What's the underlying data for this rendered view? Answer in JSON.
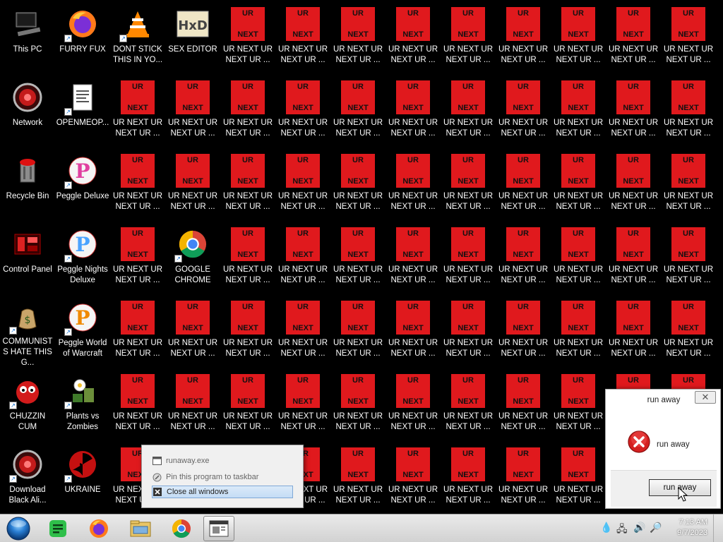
{
  "desktop": {
    "col1": [
      {
        "label": "This PC",
        "icon": "computer-icon"
      },
      {
        "label": "Network",
        "icon": "network-icon"
      },
      {
        "label": "Recycle Bin",
        "icon": "recycle-bin-icon"
      },
      {
        "label": "Control Panel",
        "icon": "control-panel-icon"
      },
      {
        "label": "COMMUNISTS HATE THIS G...",
        "icon": "money-bag-icon"
      },
      {
        "label": "CHUZZIN CUM",
        "icon": "chuzzle-icon"
      },
      {
        "label": "Download Black Ali...",
        "icon": "alien-icon"
      }
    ],
    "col2": [
      {
        "label": "FURRY FUX",
        "icon": "firefox-icon"
      },
      {
        "label": "OPENMEOP...",
        "icon": "document-icon"
      },
      {
        "label": "Peggle Deluxe",
        "icon": "peggle-icon"
      },
      {
        "label": "Peggle Nights Deluxe",
        "icon": "peggle-nights-icon"
      },
      {
        "label": "Peggle World of Warcraft",
        "icon": "peggle-wow-icon"
      },
      {
        "label": "Plants vs Zombies",
        "icon": "plants-icon"
      },
      {
        "label": "UKRAINE",
        "icon": "radiation-icon"
      }
    ],
    "col3_top": [
      {
        "label": "DONT STICK THIS IN YO...",
        "icon": "vlc-icon"
      },
      {
        "label": "SEX EDITOR",
        "icon": "hxd-icon"
      }
    ],
    "chrome": {
      "label": "GOOGLE CHROME",
      "icon": "chrome-icon"
    },
    "ur_icon": {
      "top": "UR",
      "bottom": "NEXT",
      "label": "UR NEXT UR NEXT UR ..."
    }
  },
  "jumplist": {
    "app": "runaway.exe",
    "pin": "Pin this program to taskbar",
    "close": "Close all windows"
  },
  "dialog": {
    "title": "run away",
    "message": "run away",
    "button": "run away"
  },
  "taskbar": {
    "time": "7:13 AM",
    "date": "9/7/2023"
  },
  "colors": {
    "ur_red": "#e0191d"
  }
}
